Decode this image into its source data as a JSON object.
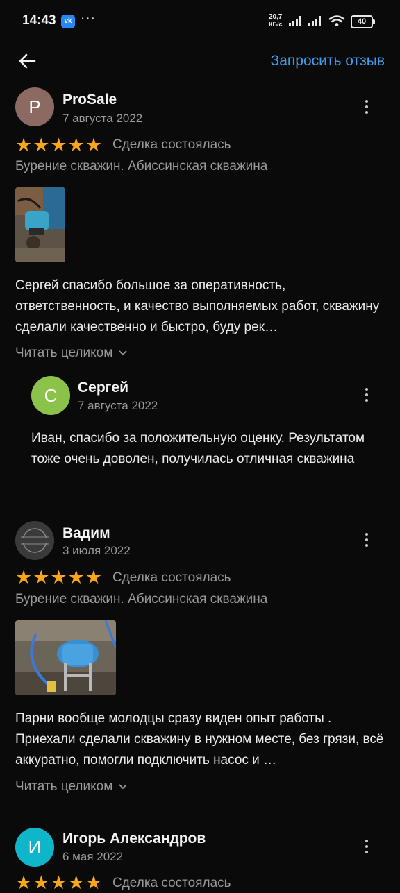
{
  "status_bar": {
    "time": "14:43",
    "vk_badge": "vk",
    "more_dots": "···",
    "net_speed_value": "20,7",
    "net_speed_unit": "КБ/с",
    "battery": "40"
  },
  "header": {
    "back_icon": "arrow-left-icon",
    "request_review_label": "Запросить отзыв",
    "accent_color": "#3e9ff1"
  },
  "reviews": [
    {
      "avatar_letter": "P",
      "avatar_color": "#8c6a62",
      "name": "ProSale",
      "date": "7 августа 2022",
      "rating": 5,
      "stars": "★★★★★",
      "deal_status": "Сделка состоялась",
      "service": "Бурение скважин. Абиссинская скважина",
      "text": "Сергей спасибо большое за оперативность, ответственность, и качество выполняемых работ, скважину сделали качественно и быстро, буду рек…",
      "read_more": "Читать целиком",
      "reply": {
        "avatar_letter": "С",
        "avatar_color": "#8bc34a",
        "name": "Сергей",
        "date": "7 августа 2022",
        "text": "Иван, спасибо за положительную оценку. Результатом тоже очень доволен, получилась отличная скважина"
      }
    },
    {
      "avatar_letter": "",
      "avatar_logo_text": "СКВОЗЬ ВЕТОЧ",
      "name": "Вадим",
      "date": "3 июля 2022",
      "rating": 5,
      "stars": "★★★★★",
      "deal_status": "Сделка состоялась",
      "service": "Бурение скважин. Абиссинская скважина",
      "text": "Парни вообще молодцы сразу виден опыт работы . Приехали сделали скважину в нужном месте, без грязи, всё аккуратно, помогли подключить насос и …",
      "read_more": "Читать целиком"
    },
    {
      "avatar_letter": "И",
      "avatar_color": "#0fb5c9",
      "name": "Игорь Александров",
      "date": "6 мая 2022",
      "rating": 5,
      "stars": "★★★★★",
      "deal_status": "Сделка состоялась"
    }
  ],
  "star_color": "#f8a61b"
}
